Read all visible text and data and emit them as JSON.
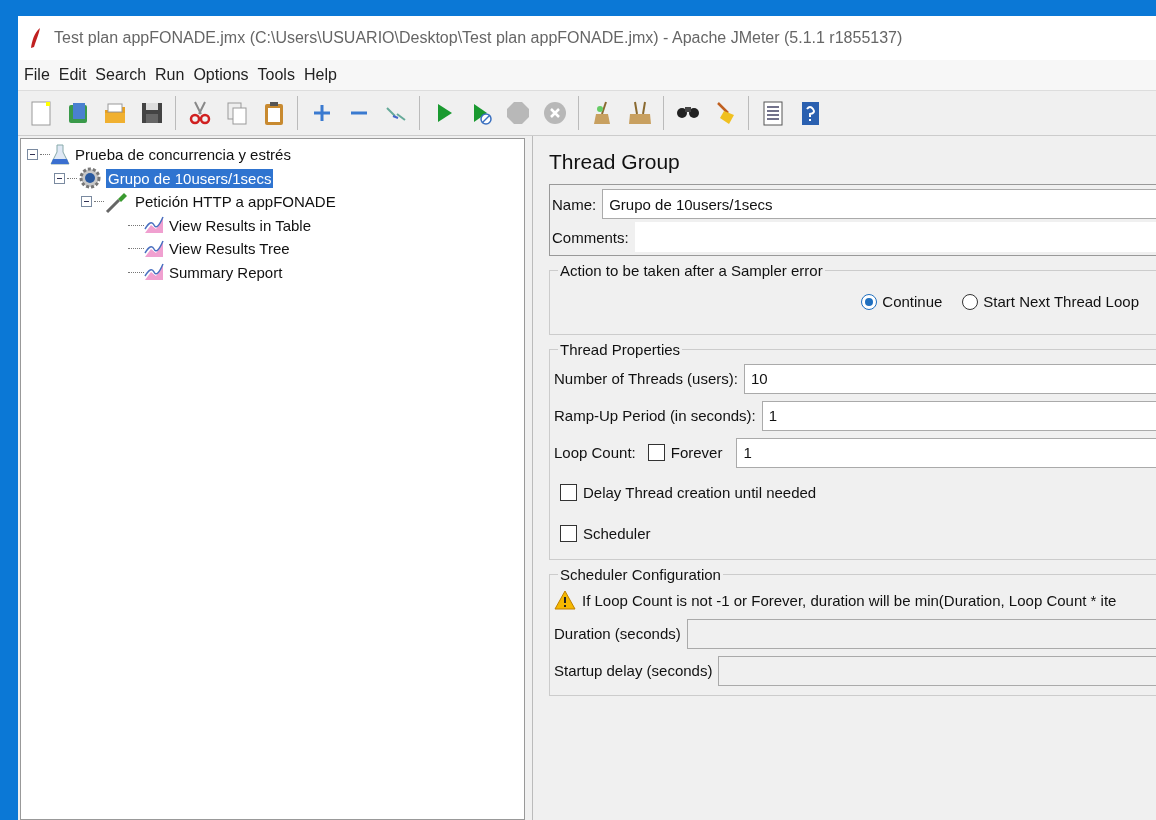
{
  "window": {
    "title": "Test plan appFONADE.jmx (C:\\Users\\USUARIO\\Desktop\\Test plan appFONADE.jmx) - Apache JMeter (5.1.1 r1855137)"
  },
  "menu": [
    "File",
    "Edit",
    "Search",
    "Run",
    "Options",
    "Tools",
    "Help"
  ],
  "tree": [
    {
      "label": "Prueba de concurrencia y estrés",
      "kind": "test-plan",
      "expanded": true,
      "selected": false,
      "children": [
        {
          "label": "Grupo de 10users/1secs",
          "kind": "thread-group",
          "expanded": true,
          "selected": true,
          "children": [
            {
              "label": "Petición HTTP a appFONADE",
              "kind": "sampler",
              "expanded": true,
              "selected": false,
              "children": [
                {
                  "label": "View Results in Table",
                  "kind": "listener",
                  "selected": false
                },
                {
                  "label": "View Results Tree",
                  "kind": "listener",
                  "selected": false
                },
                {
                  "label": "Summary Report",
                  "kind": "listener",
                  "selected": false
                }
              ]
            }
          ]
        }
      ]
    }
  ],
  "editor": {
    "title": "Thread Group",
    "name": {
      "label": "Name:",
      "value": "Grupo de 10users/1secs"
    },
    "comments": {
      "label": "Comments:"
    },
    "sampler_error": {
      "legend": "Action to be taken after a Sampler error",
      "options": [
        {
          "label": "Continue",
          "selected": true
        },
        {
          "label": "Start Next Thread Loop",
          "selected": false
        }
      ]
    },
    "thread_properties": {
      "legend": "Thread Properties",
      "threads": {
        "label": "Number of Threads (users):",
        "value": "10"
      },
      "ramp_up": {
        "label": "Ramp-Up Period (in seconds):",
        "value": "1"
      },
      "loop_count": {
        "label": "Loop Count:",
        "forever": {
          "label": "Forever",
          "checked": false
        },
        "value": "1"
      },
      "delay": {
        "label": "Delay Thread creation until needed",
        "checked": false
      },
      "scheduler": {
        "label": "Scheduler",
        "checked": false
      }
    },
    "scheduler_config": {
      "legend": "Scheduler Configuration",
      "warning": "If Loop Count is not -1 or Forever, duration will be min(Duration, Loop Count * ite",
      "duration": {
        "label": "Duration (seconds)",
        "disabled": true
      },
      "startup_delay": {
        "label": "Startup delay (seconds)",
        "disabled": true
      }
    }
  }
}
